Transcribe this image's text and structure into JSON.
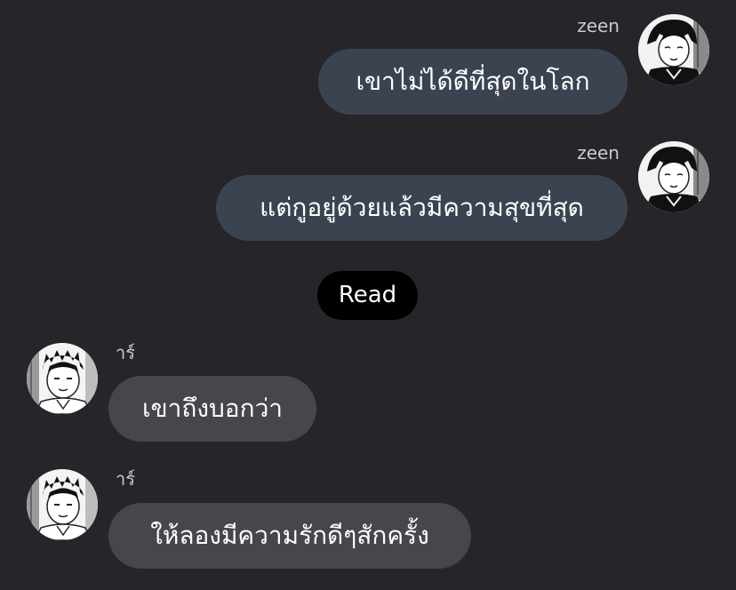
{
  "messages": [
    {
      "sender": "zeen",
      "direction": "outgoing",
      "text": "เขาไม่ได้ดีที่สุดในโลก"
    },
    {
      "sender": "zeen",
      "direction": "outgoing",
      "text": "แต่กูอยู่ด้วยแล้วมีความสุขที่สุด"
    },
    {
      "sender": "าร์",
      "direction": "incoming",
      "text": "เขาถึงบอกว่า"
    },
    {
      "sender": "าร์",
      "direction": "incoming",
      "text": "ให้ลองมีความรักดีๆสักครั้ง"
    }
  ],
  "read_status": "Read",
  "colors": {
    "background": "#25252a",
    "outgoing_bubble": "#3c4350",
    "incoming_bubble": "#46464c",
    "read_pill": "#000000"
  },
  "icons": {
    "outgoing_avatar": "avatar-dark-hair-character",
    "incoming_avatar": "avatar-spiky-hair-character"
  }
}
